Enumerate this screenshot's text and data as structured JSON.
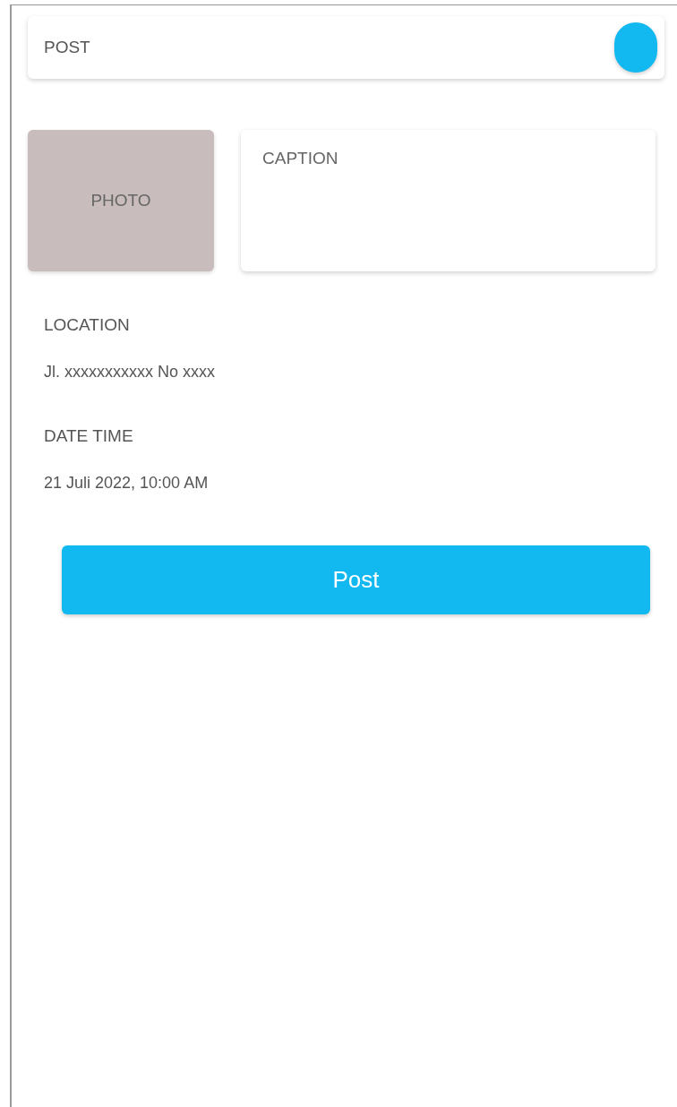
{
  "header": {
    "title": "POST"
  },
  "photo": {
    "label": "PHOTO"
  },
  "caption": {
    "placeholder": "CAPTION"
  },
  "fields": [
    {
      "label": "LOCATION",
      "value": "Jl. xxxxxxxxxxx No xxxx"
    },
    {
      "label": "DATE TIME",
      "value": "21 Juli 2022, 10:00 AM"
    }
  ],
  "button": {
    "label": "Post"
  }
}
